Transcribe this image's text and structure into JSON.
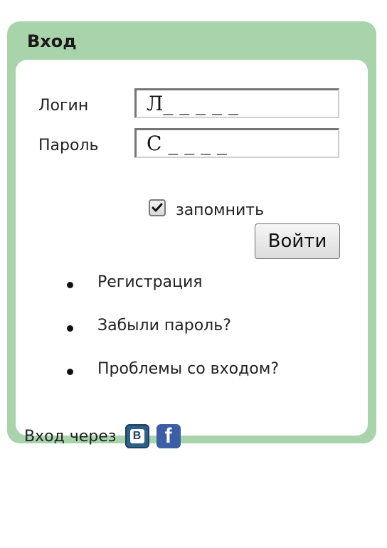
{
  "panel": {
    "title": "Вход"
  },
  "form": {
    "login_label": "Логин",
    "login_value": "Л_ _ _ _ _",
    "password_label": "Пароль",
    "password_value": "С _ _ _ _",
    "remember_label": "запомнить",
    "remember_checked": true,
    "submit_label": "Войти"
  },
  "links": [
    {
      "label": "Регистрация"
    },
    {
      "label": "Забыли пароль?"
    },
    {
      "label": "Проблемы со входом?"
    }
  ],
  "social": {
    "label": "Вход через",
    "vk_glyph": "B",
    "fb_glyph": "f",
    "icons": [
      "vk-icon",
      "facebook-icon"
    ]
  },
  "colors": {
    "panel": "#a8d3ab",
    "vk": "#2e5e8a",
    "facebook": "#3b5ea6"
  }
}
